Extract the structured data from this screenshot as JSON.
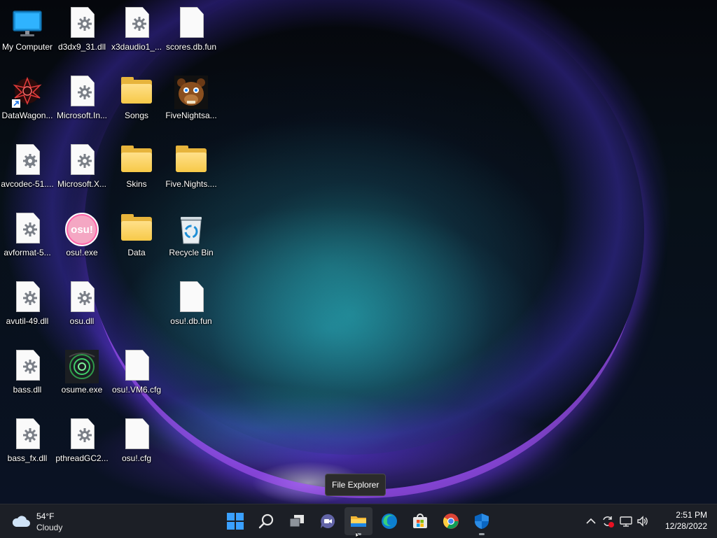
{
  "desktop_icons": [
    {
      "label": "My Computer",
      "icon": "monitor-icon"
    },
    {
      "label": "d3dx9_31.dll",
      "icon": "dll-file-icon"
    },
    {
      "label": "x3daudio1_...",
      "icon": "dll-file-icon"
    },
    {
      "label": "scores.db.fun",
      "icon": "blank-file-icon"
    },
    {
      "label": "DataWagon...",
      "icon": "shortcut-app-icon"
    },
    {
      "label": "Microsoft.In...",
      "icon": "dll-file-icon"
    },
    {
      "label": "Songs",
      "icon": "folder-icon"
    },
    {
      "label": "FiveNightsa...",
      "icon": "freddy-app-icon"
    },
    {
      "label": "avcodec-51....",
      "icon": "dll-file-icon"
    },
    {
      "label": "Microsoft.X...",
      "icon": "dll-file-icon"
    },
    {
      "label": "Skins",
      "icon": "folder-icon"
    },
    {
      "label": "Five.Nights....",
      "icon": "folder-icon"
    },
    {
      "label": "avformat-5...",
      "icon": "dll-file-icon"
    },
    {
      "label": "osu!.exe",
      "icon": "osu-app-icon"
    },
    {
      "label": "Data",
      "icon": "folder-icon"
    },
    {
      "label": "Recycle Bin",
      "icon": "recycle-bin-icon"
    },
    {
      "label": "avutil-49.dll",
      "icon": "dll-file-icon"
    },
    {
      "label": "osu.dll",
      "icon": "dll-file-icon"
    },
    {
      "label": "osu!.db.fun",
      "icon": "blank-file-icon"
    },
    {
      "label": "bass.dll",
      "icon": "dll-file-icon"
    },
    {
      "label": "osume.exe",
      "icon": "osume-app-icon"
    },
    {
      "label": "osu!.VM6.cfg",
      "icon": "blank-file-icon"
    },
    {
      "label": "bass_fx.dll",
      "icon": "dll-file-icon"
    },
    {
      "label": "pthreadGC2...",
      "icon": "dll-file-icon"
    },
    {
      "label": "osu!.cfg",
      "icon": "blank-file-icon"
    }
  ],
  "tooltip": {
    "text": "File Explorer"
  },
  "weather": {
    "temp": "54°F",
    "condition": "Cloudy"
  },
  "taskbar_apps": [
    {
      "name": "start",
      "icon": "windows-logo-icon"
    },
    {
      "name": "search",
      "icon": "search-icon"
    },
    {
      "name": "task-view",
      "icon": "task-view-icon"
    },
    {
      "name": "chat",
      "icon": "teams-chat-icon"
    },
    {
      "name": "file-explorer",
      "icon": "file-explorer-icon",
      "active": true
    },
    {
      "name": "edge",
      "icon": "edge-icon"
    },
    {
      "name": "store",
      "icon": "microsoft-store-icon"
    },
    {
      "name": "chrome",
      "icon": "chrome-icon"
    },
    {
      "name": "security",
      "icon": "windows-security-icon",
      "running": true
    }
  ],
  "tray": {
    "icons": [
      "chevron-up-icon",
      "sync-alert-icon",
      "network-icon",
      "volume-icon"
    ]
  },
  "clock": {
    "time": "2:51 PM",
    "date": "12/28/2022"
  },
  "colors": {
    "taskbar_bg": "#1c1f26",
    "folder": "#f7c948",
    "accent_blue": "#0078d4"
  }
}
